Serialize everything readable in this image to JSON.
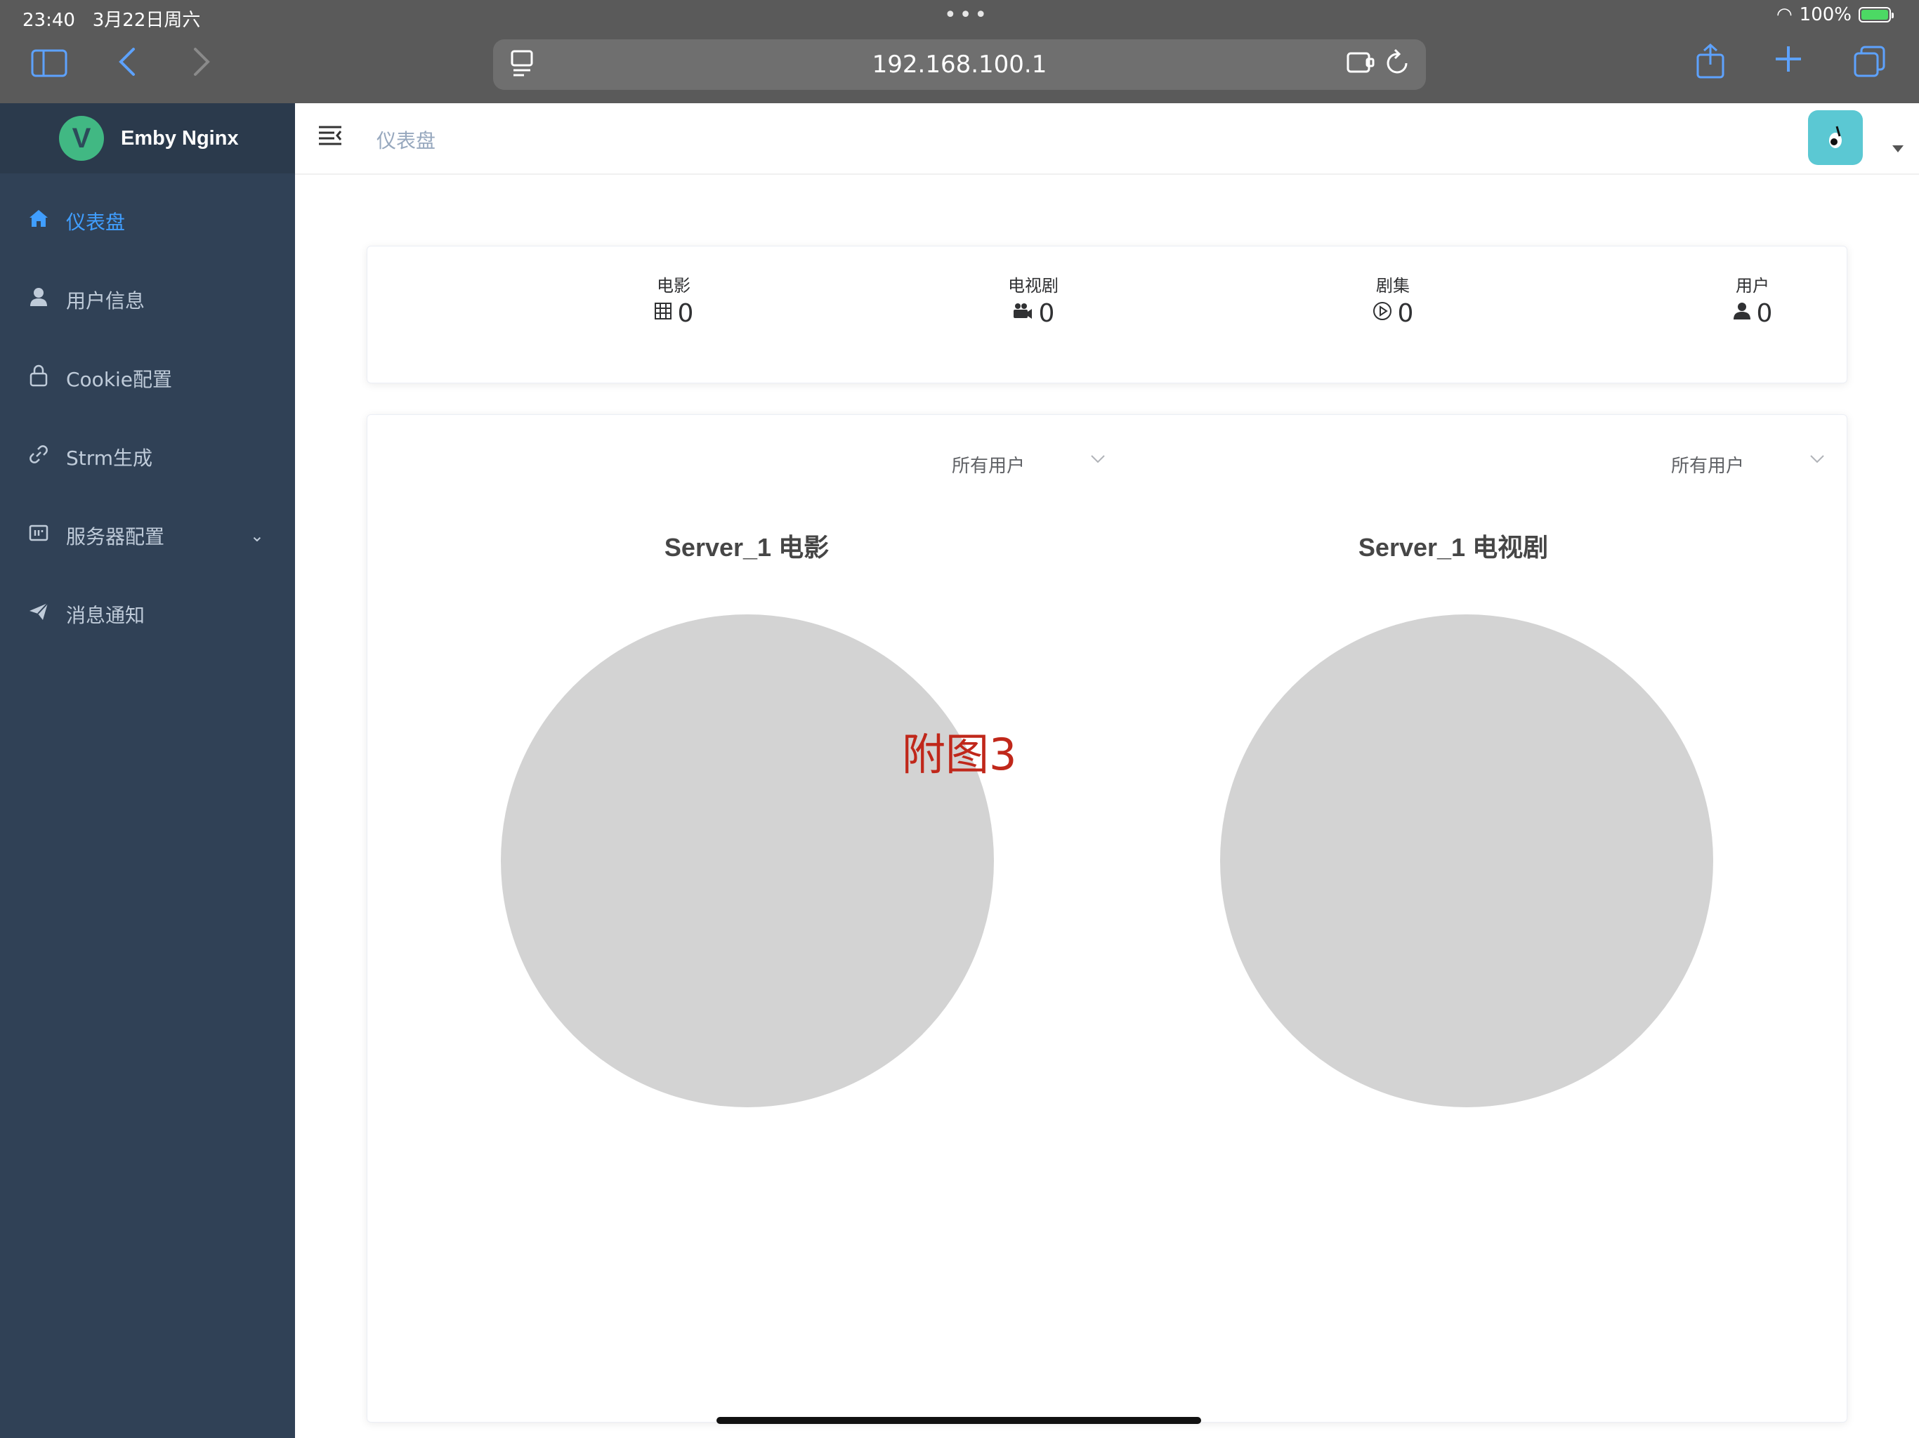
{
  "status_bar": {
    "time": "23:40",
    "date": "3月22日周六",
    "battery": "100%"
  },
  "browser": {
    "url": "192.168.100.1",
    "icons": [
      "sidebar-icon",
      "back-icon",
      "forward-icon",
      "reader-icon",
      "extension-icon",
      "reload-icon",
      "share-icon",
      "new-tab-icon",
      "tabs-icon"
    ]
  },
  "sidebar": {
    "app_title": "Emby Nginx",
    "logo_letter": "V",
    "items": [
      {
        "label": "仪表盘",
        "icon": "home-icon",
        "active": true
      },
      {
        "label": "用户信息",
        "icon": "user-icon"
      },
      {
        "label": "Cookie配置",
        "icon": "lock-icon"
      },
      {
        "label": "Strm生成",
        "icon": "link-icon"
      },
      {
        "label": "服务器配置",
        "icon": "server-icon",
        "has_submenu": true
      },
      {
        "label": "消息通知",
        "icon": "send-icon"
      }
    ]
  },
  "navbar": {
    "breadcrumb": "仪表盘"
  },
  "stats": [
    {
      "label": "电影",
      "value": "0",
      "icon": "grid-icon"
    },
    {
      "label": "电视剧",
      "value": "0",
      "icon": "camera-icon"
    },
    {
      "label": "剧集",
      "value": "0",
      "icon": "play-icon"
    },
    {
      "label": "用户",
      "value": "0",
      "icon": "person-icon"
    }
  ],
  "filters": [
    {
      "value": "所有用户"
    },
    {
      "value": "所有用户"
    }
  ],
  "colors": {
    "sidebar_bg": "#304156",
    "active": "#409eff",
    "pie_empty": "#d3d3d3",
    "annotation": "#c0271a"
  },
  "chart_data": [
    {
      "type": "pie",
      "title": "Server_1 电影",
      "categories": [],
      "values": []
    },
    {
      "type": "pie",
      "title": "Server_1 电视剧",
      "categories": [],
      "values": []
    }
  ],
  "annotation": "附图3"
}
